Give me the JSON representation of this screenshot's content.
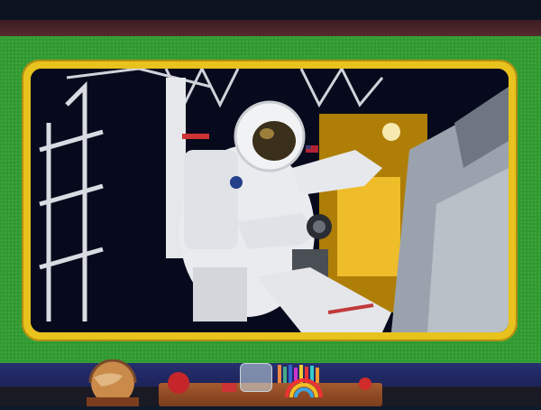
{
  "scene": {
    "description_free": true,
    "colors": {
      "wall_green": "#2f9a2f",
      "frame_yellow": "#e8c21d",
      "space_black": "#0a0c1a",
      "desk_wood": "#a65a2e"
    },
    "icons": [
      "globe-icon",
      "apple-icon",
      "pencil-cup-icon",
      "rainbow-icon"
    ]
  }
}
